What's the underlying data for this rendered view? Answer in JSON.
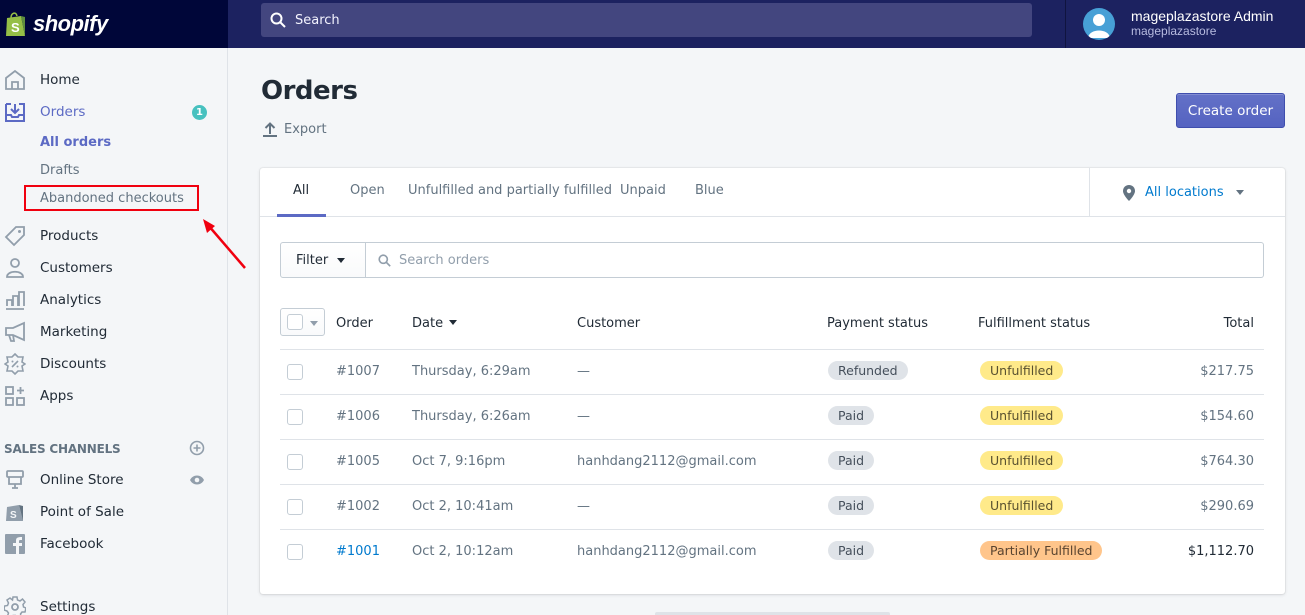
{
  "topbar": {
    "brand": "shopify",
    "search_placeholder": "Search",
    "user_name": "mageplazastore Admin",
    "user_store": "mageplazastore"
  },
  "sidebar": {
    "items": [
      {
        "label": "Home",
        "icon": "home-icon"
      },
      {
        "label": "Orders",
        "icon": "orders-icon",
        "badge": "1",
        "active": true
      },
      {
        "label": "Products",
        "icon": "tag-icon"
      },
      {
        "label": "Customers",
        "icon": "person-icon"
      },
      {
        "label": "Analytics",
        "icon": "bar-chart-icon"
      },
      {
        "label": "Marketing",
        "icon": "megaphone-icon"
      },
      {
        "label": "Discounts",
        "icon": "discount-icon"
      },
      {
        "label": "Apps",
        "icon": "apps-icon"
      }
    ],
    "orders_subitems": [
      {
        "label": "All orders",
        "active": true
      },
      {
        "label": "Drafts"
      },
      {
        "label": "Abandoned checkouts",
        "highlighted": true
      }
    ],
    "sales_channels_heading": "SALES CHANNELS",
    "channels": [
      {
        "label": "Online Store",
        "icon": "store-icon"
      },
      {
        "label": "Point of Sale",
        "icon": "pos-bag-icon"
      },
      {
        "label": "Facebook",
        "icon": "facebook-icon"
      }
    ],
    "settings_label": "Settings"
  },
  "page": {
    "title": "Orders",
    "export_label": "Export",
    "create_button": "Create order"
  },
  "tabs": {
    "items": [
      "All",
      "Open",
      "Unfulfilled and partially fulfilled",
      "Unpaid",
      "Blue"
    ],
    "active": "All",
    "location_label": "All locations"
  },
  "filter": {
    "button_label": "Filter",
    "search_placeholder": "Search orders"
  },
  "table": {
    "columns": [
      "Order",
      "Date",
      "Customer",
      "Payment status",
      "Fulfillment status",
      "Total"
    ],
    "rows": [
      {
        "order": "#1007",
        "date": "Thursday, 6:29am",
        "customer": "—",
        "payment": "Refunded",
        "fulfillment": "Unfulfilled",
        "total": "$217.75"
      },
      {
        "order": "#1006",
        "date": "Thursday, 6:26am",
        "customer": "—",
        "payment": "Paid",
        "fulfillment": "Unfulfilled",
        "total": "$154.60"
      },
      {
        "order": "#1005",
        "date": "Oct 7, 9:16pm",
        "customer": "hanhdang2112@gmail.com",
        "payment": "Paid",
        "fulfillment": "Unfulfilled",
        "total": "$764.30"
      },
      {
        "order": "#1002",
        "date": "Oct 2, 10:41am",
        "customer": "—",
        "payment": "Paid",
        "fulfillment": "Unfulfilled",
        "total": "$290.69"
      },
      {
        "order": "#1001",
        "date": "Oct 2, 10:12am",
        "customer": "hanhdang2112@gmail.com",
        "payment": "Paid",
        "fulfillment": "Partially Fulfilled",
        "total": "$1,112.70"
      }
    ]
  },
  "colors": {
    "topbar": "#1c2260",
    "logo_bg": "#000639",
    "accent": "#5c6ac4",
    "link": "#007ace",
    "badge": "#47c1bf",
    "unfulfilled": "#ffea8a",
    "partially_fulfilled": "#ffc58b",
    "highlight_annotation": "#f0000f"
  }
}
